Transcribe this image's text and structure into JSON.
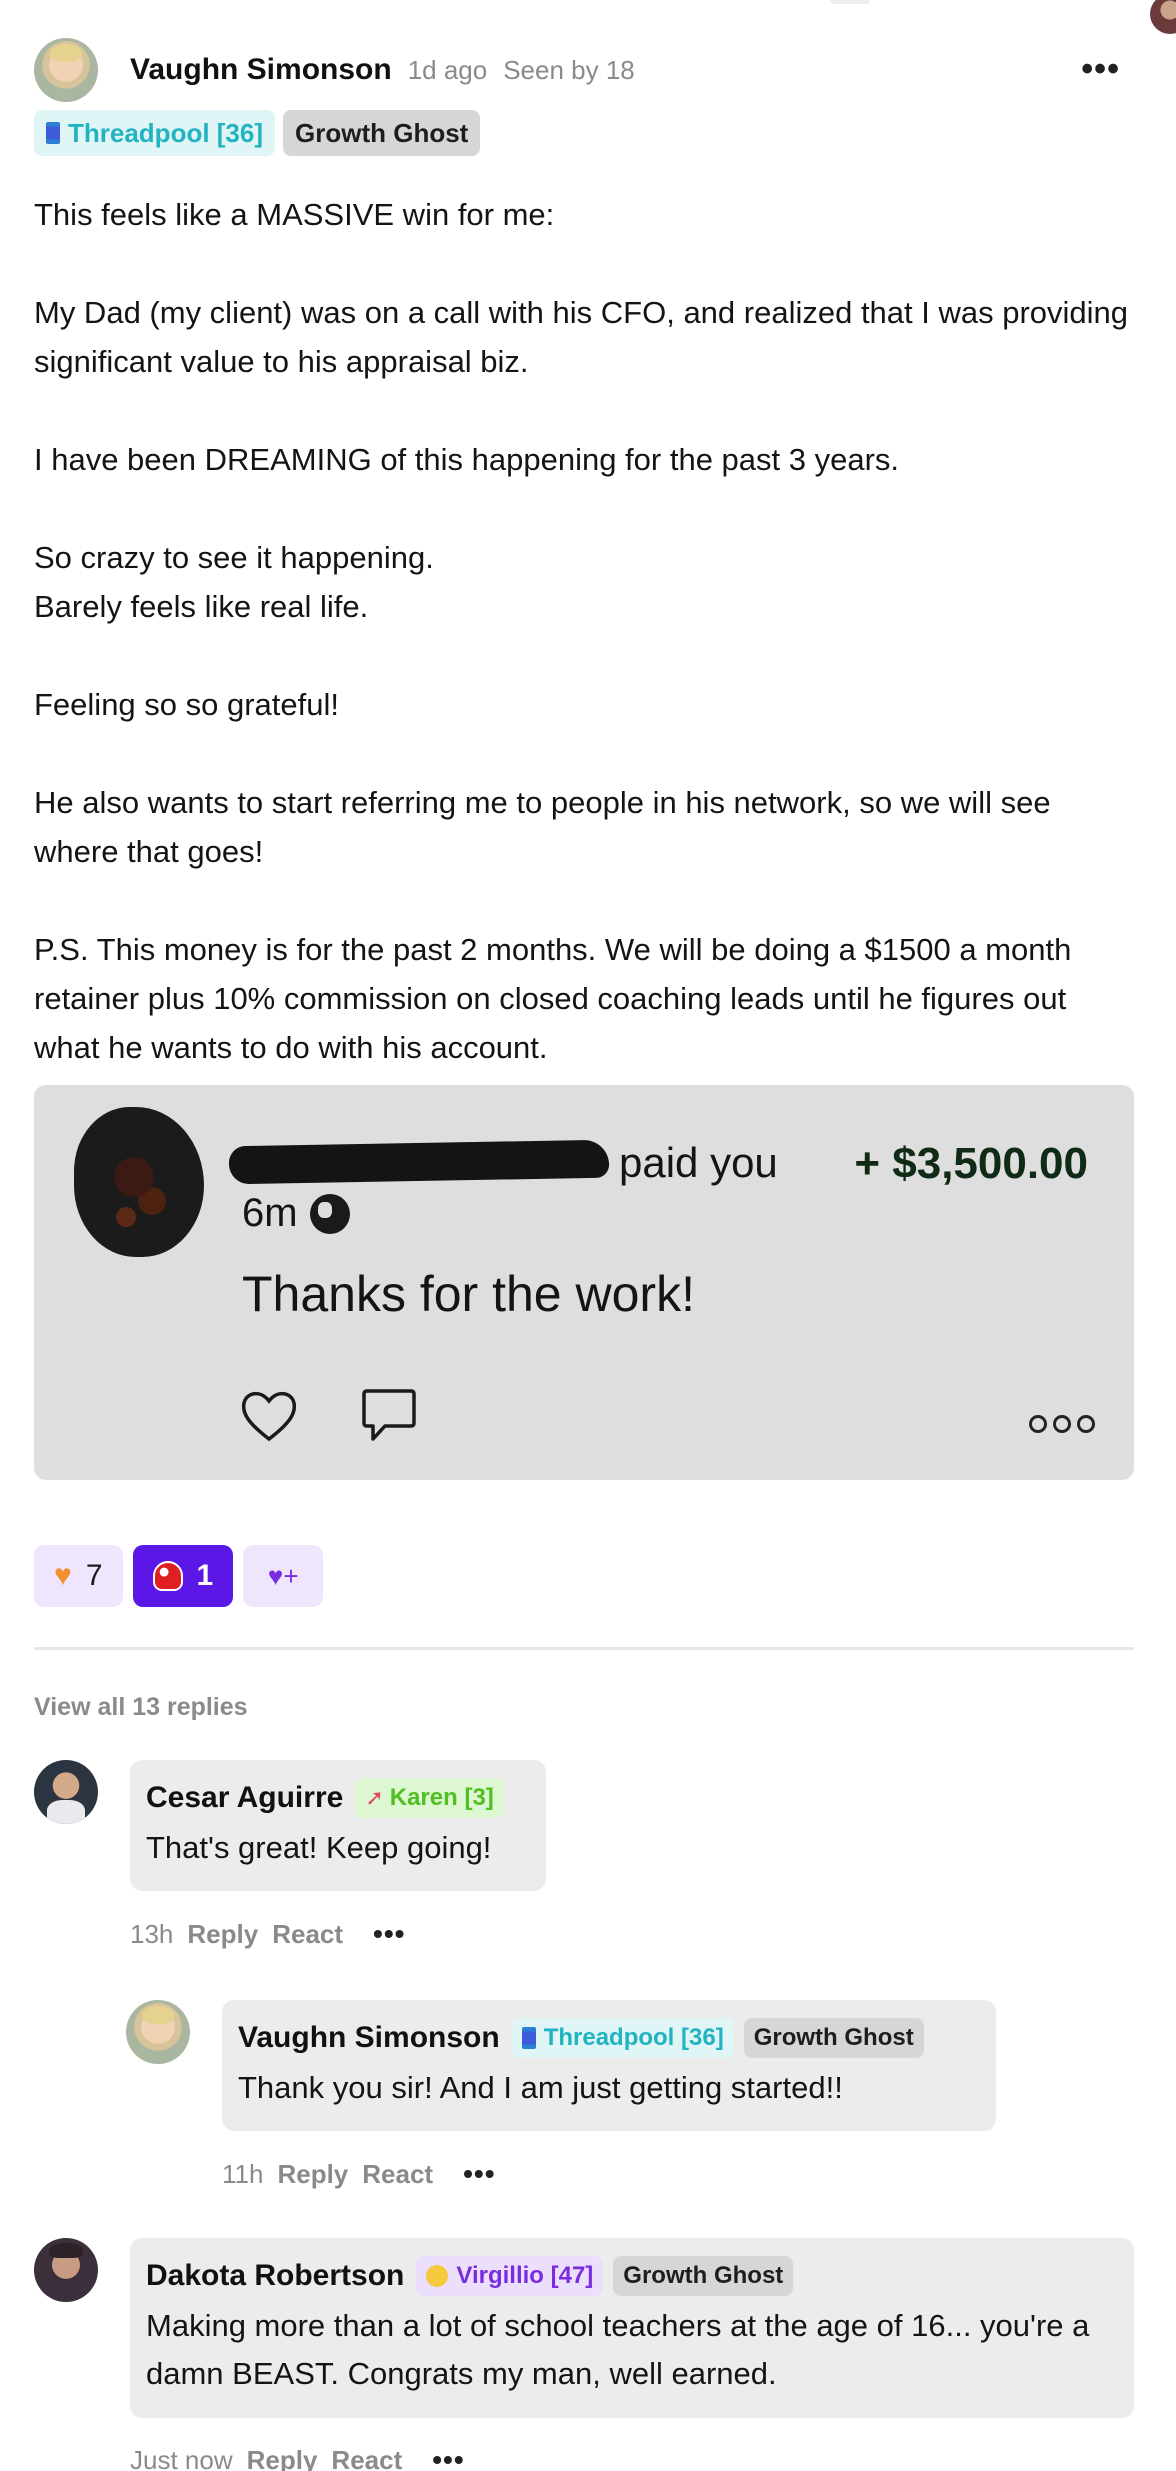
{
  "post": {
    "author": "Vaughn Simonson",
    "time": "1d ago",
    "seen": "Seen by 18",
    "more_label": "•••",
    "badges": [
      {
        "label": "Threadpool [36]"
      },
      {
        "label": "Growth Ghost"
      }
    ],
    "body": [
      "This feels like a MASSIVE win for me:",
      "My Dad (my client) was on a call with his CFO, and realized that I was providing significant value to his appraisal biz.",
      "I have been DREAMING of this happening for the past 3 years.",
      "So crazy to see it happening.",
      "Barely feels like real life.",
      "Feeling so so grateful!",
      "He also wants to start referring me to people in his network, so we will see where that goes!",
      "P.S. This money is for the past 2 months. We will be doing a $1500 a month retainer plus 10% commission on closed coaching leads until he figures out what he wants to do with his account."
    ]
  },
  "payment": {
    "paid_text": "paid you",
    "amount": "+ $3,500.00",
    "time": "6m",
    "note": "Thanks for the work!",
    "icons": [
      "heart-icon",
      "comment-icon",
      "more-icon",
      "globe-icon"
    ]
  },
  "reactions": [
    {
      "emoji": "orange-heart",
      "count": "7"
    },
    {
      "emoji": "mushroom",
      "count": "1"
    }
  ],
  "view_all": "View all 13 replies",
  "comments": [
    {
      "author": "Cesar Aguirre",
      "badges": [
        {
          "label": "Karen [3]"
        }
      ],
      "text": "That's great! Keep going!",
      "time": "13h",
      "reply": "Reply",
      "react": "React",
      "dots": "•••"
    },
    {
      "author": "Vaughn Simonson",
      "badges": [
        {
          "label": "Threadpool [36]"
        },
        {
          "label": "Growth Ghost"
        }
      ],
      "text": "Thank you sir! And I am just getting started!!",
      "time": "11h",
      "reply": "Reply",
      "react": "React",
      "dots": "•••"
    },
    {
      "author": "Dakota Robertson",
      "badges": [
        {
          "label": "Virgillio [47]"
        },
        {
          "label": "Growth Ghost"
        }
      ],
      "text": "Making more than a lot of school teachers at the age of 16... you're a damn BEAST. Congrats my man, well earned.",
      "time": "Just now",
      "reply": "Reply",
      "react": "React",
      "dots": "•••"
    }
  ]
}
